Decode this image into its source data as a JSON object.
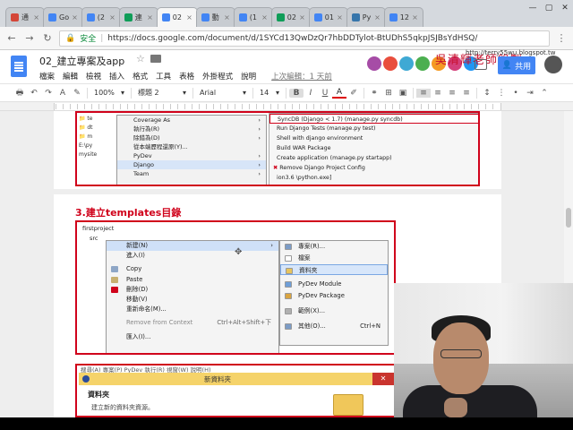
{
  "tabs": [
    {
      "label": "通",
      "color": "#d44638"
    },
    {
      "label": "Go",
      "color": "#4285f4"
    },
    {
      "label": "(2",
      "color": "#4285f4"
    },
    {
      "label": "連",
      "color": "#0f9d58"
    },
    {
      "label": "02",
      "color": "#4285f4",
      "active": true
    },
    {
      "label": "動",
      "color": "#4285f4"
    },
    {
      "label": "(1",
      "color": "#4285f4"
    },
    {
      "label": "02",
      "color": "#0f9d58"
    },
    {
      "label": "01",
      "color": "#4285f4"
    },
    {
      "label": "Py",
      "color": "#3776ab"
    },
    {
      "label": "12",
      "color": "#4285f4"
    }
  ],
  "window_controls": [
    "—",
    "▢",
    "✕"
  ],
  "address": {
    "secure_label": "安全",
    "url": "https://docs.google.com/document/d/1SYCd13QwDzQr7hbDDTylot-BtUDhS5qkpJSJBsYdHSQ/"
  },
  "docs": {
    "title": "02_建立專案及app",
    "menu": [
      "檔案",
      "編輯",
      "檢視",
      "插入",
      "格式",
      "工具",
      "表格",
      "外掛程式",
      "說明"
    ],
    "last_edit": "上次編輯：1 天前",
    "share_label": "共用",
    "watermark": "吳清輝老師錄製",
    "blog": "http://terry55wu.blogspot.tw"
  },
  "toolbar": {
    "zoom": "100%",
    "style": "標題 2",
    "font": "Arial",
    "size": "14"
  },
  "colors": {
    "accent": "#d0021b",
    "docs_blue": "#4285f4"
  },
  "shot1": {
    "tree": [
      "📁 te",
      "📁 dt",
      "📁 m",
      "E:\\py",
      "mysite"
    ],
    "menu": [
      {
        "label": "Coverage As",
        "arrow": "›"
      },
      {
        "label": "執行為(R)",
        "arrow": "›"
      },
      {
        "label": "除錯為(D)",
        "arrow": "›"
      },
      {
        "label": "從本端歷程還原(Y)..."
      },
      {
        "label": "PyDev",
        "arrow": "›"
      },
      {
        "label": "Django",
        "arrow": "›",
        "hl": true
      },
      {
        "label": "Team",
        "arrow": "›"
      }
    ],
    "submenu": [
      {
        "label": "SyncDB (Django < 1.7) (manage.py syncdb)",
        "boxed": true
      },
      {
        "label": "Run Django Tests (manage.py test)"
      },
      {
        "label": "Shell with django environment"
      },
      {
        "label": "Build WAR Package"
      },
      {
        "label": "Create application (manage.py startapp)"
      },
      {
        "label": "Remove Django Project Config",
        "icon": "remove"
      },
      {
        "label": "ion3.6 \\python.exe]"
      }
    ]
  },
  "heading": "3.建立templates目錄",
  "shot2": {
    "tree": [
      "firstproject",
      "src"
    ],
    "menu": [
      {
        "label": "新建(N)",
        "arrow": "›",
        "hl": true
      },
      {
        "label": "進入(I)"
      },
      {
        "label": "Copy",
        "icon": "#8ea6c6"
      },
      {
        "label": "Paste",
        "icon": "#c8b070"
      },
      {
        "label": "刪除(D)",
        "icon": "#d0021b"
      },
      {
        "label": "移動(V)"
      },
      {
        "label": "重新命名(M)..."
      },
      {
        "label": "Remove from Context",
        "kbd": "Ctrl+Alt+Shift+下",
        "dim": true
      },
      {
        "label": "匯入(I)..."
      }
    ],
    "submenu": [
      {
        "label": "專案(R)...",
        "icon": "#7c9cc6"
      },
      {
        "label": "檔案",
        "icon": "#ffffff"
      },
      {
        "label": "資料夾",
        "icon": "#e8c45c",
        "boxed": true
      },
      {
        "label": "PyDev Module",
        "icon": "#6f9fd8"
      },
      {
        "label": "PyDev Package",
        "icon": "#d9a441"
      },
      {
        "label": "範例(X)...",
        "icon": "#b0b0b0"
      },
      {
        "label": "其他(O)...",
        "icon": "#7c9cc6",
        "kbd": "Ctrl+N"
      }
    ]
  },
  "shot3": {
    "menurow": "搜尋(A) 專案(P) PyDev 執行(R) 視窗(W) 說明(H)",
    "window_title": "新資料夾",
    "heading": "資料夾",
    "desc": "建立新的資料夾資源。"
  }
}
